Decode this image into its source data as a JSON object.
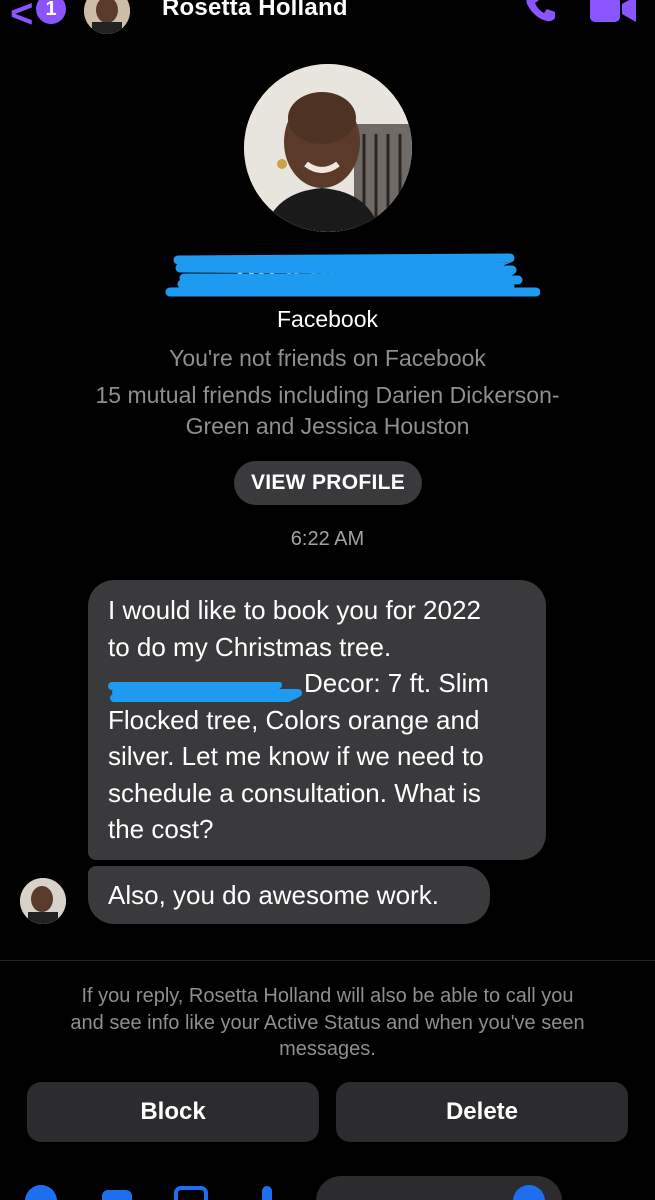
{
  "header": {
    "back_badge": "1",
    "contact_name": "Rosetta Holland",
    "accent_color": "#8a55ff",
    "icons": [
      "back-chevron-icon",
      "call-icon",
      "video-call-icon"
    ]
  },
  "profile": {
    "name": "Rosetta Holland",
    "source": "Facebook",
    "friend_status": "You're not friends on Facebook",
    "mutual_line1": "15 mutual friends including Darien Dickerson-",
    "mutual_line2": "Green and Jessica Houston",
    "view_profile_label": "VIEW PROFILE"
  },
  "conversation": {
    "timestamp": "6:22 AM",
    "messages": [
      {
        "line1": "I would like to book you for 2022",
        "line2": "to do my Christmas tree.",
        "line3_visible": "Decor: 7 ft. Slim",
        "line4": "Flocked tree, Colors orange and",
        "line5": "silver. Let me know if we need to",
        "line6": "schedule a consultation. What is",
        "line7": "the cost?"
      },
      {
        "text": "Also, you do awesome work."
      }
    ]
  },
  "footer": {
    "reply_line1": "If you reply, Rosetta Holland will also be able to call you",
    "reply_line2": "and see info like your Active Status and when you've seen",
    "reply_line3": "messages.",
    "block_label": "Block",
    "delete_label": "Delete"
  },
  "colors": {
    "background": "#000000",
    "bubble": "#3a3a3c",
    "button": "#2c2c2e",
    "secondary_text": "#8e8e93",
    "redaction": "#1e9bf0",
    "accent": "#8a55ff"
  }
}
